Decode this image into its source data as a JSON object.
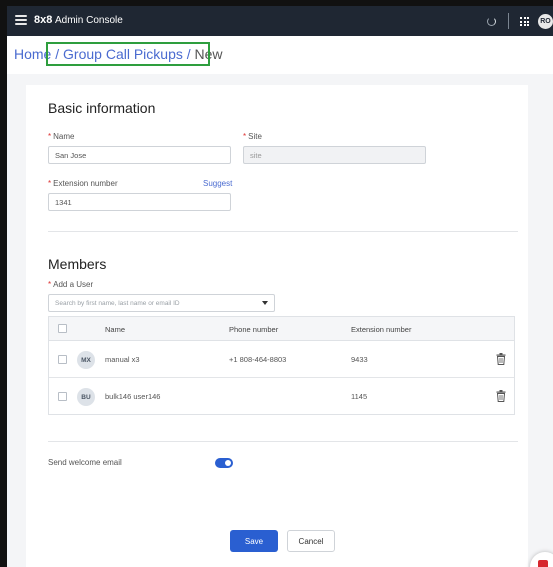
{
  "topbar": {
    "brand": "8x8",
    "title": "Admin Console",
    "avatar_initials": "RO"
  },
  "breadcrumb": {
    "home": "Home",
    "separator": "/",
    "group": "Group Call Pickups",
    "current": "New"
  },
  "basic_info": {
    "title": "Basic information",
    "name_label": "Name",
    "name_value": "San Jose",
    "site_label": "Site",
    "site_value": "site",
    "extension_label": "Extension number",
    "extension_value": "1341",
    "suggest_label": "Suggest"
  },
  "members": {
    "title": "Members",
    "add_user_label": "Add a User",
    "search_placeholder": "Search by first name, last name or email ID",
    "columns": [
      "Name",
      "Phone number",
      "Extension number"
    ],
    "rows": [
      {
        "initials": "MX",
        "name": "manual x3",
        "phone": "+1 808-464-8803",
        "extension": "9433"
      },
      {
        "initials": "BU",
        "name": "bulk146 user146",
        "phone": "",
        "extension": "1145"
      }
    ]
  },
  "welcome": {
    "label": "Send welcome email",
    "enabled": true
  },
  "actions": {
    "save": "Save",
    "cancel": "Cancel"
  },
  "colors": {
    "topbar": "#1f2733",
    "accent": "#2a5fd1",
    "link": "#4a6bd0",
    "highlight": "#2e9e3e",
    "required": "#d33333"
  }
}
